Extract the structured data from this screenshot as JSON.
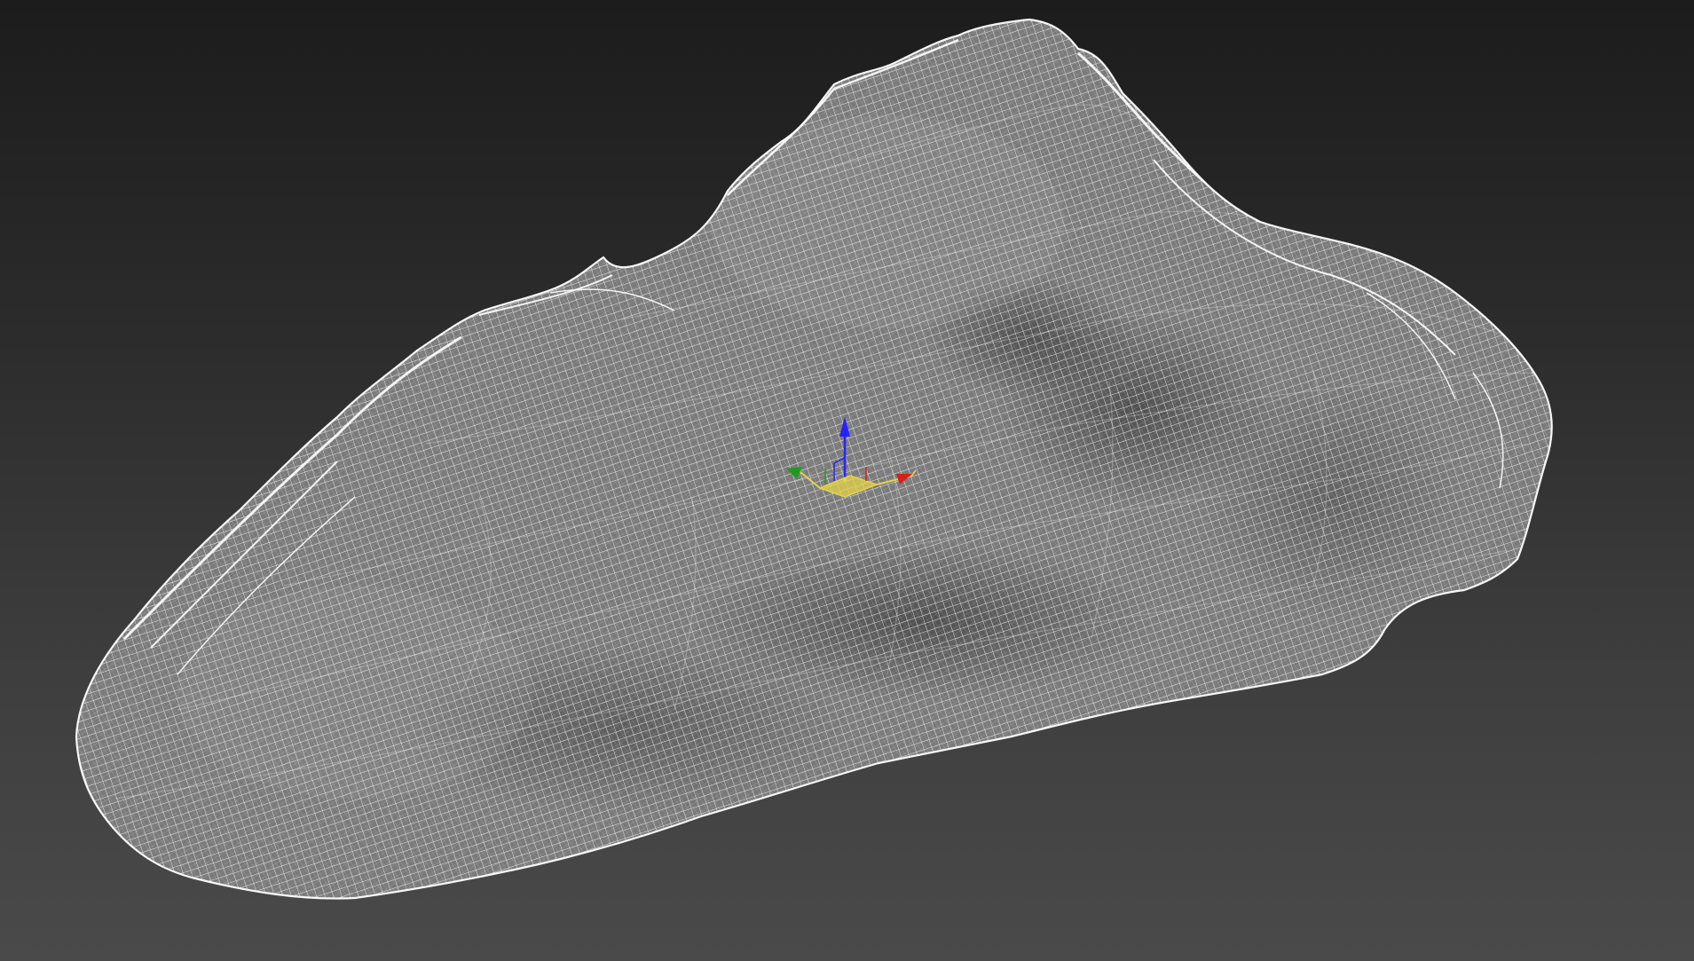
{
  "viewport": {
    "background_top": "#1c1c1c",
    "background_bottom": "#4a4a4a",
    "wire_color": "#ffffff",
    "surface_color": "#7c7c7c"
  },
  "gizmo": {
    "x_axis_color": "#d42020",
    "y_axis_color": "#1f9a1f",
    "z_axis_color": "#2323ff",
    "plane_color": "#e6d34a"
  }
}
